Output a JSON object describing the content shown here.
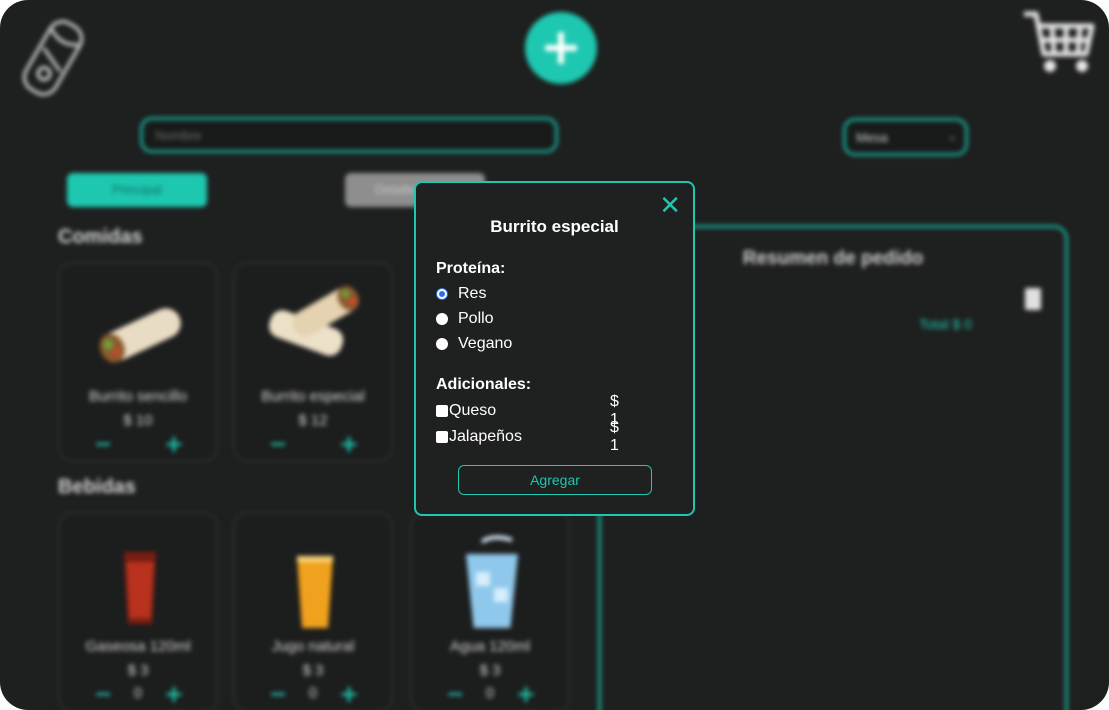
{
  "header": {
    "logo_icon": "burrito-logo-icon",
    "add_icon": "plus-icon",
    "cart_icon": "cart-icon"
  },
  "search": {
    "placeholder": "Nombre"
  },
  "filter": {
    "selected": "Mesa"
  },
  "tabs": [
    {
      "label": "Principal"
    },
    {
      "label": "Detalles"
    }
  ],
  "sections": {
    "comidas": {
      "title": "Comidas",
      "items": [
        {
          "name": "Burrito sencillo",
          "price": "$ 10"
        },
        {
          "name": "Burrito especial",
          "price": "$ 12"
        }
      ]
    },
    "bebidas": {
      "title": "Bebidas",
      "items": [
        {
          "name": "Gaseosa 120ml",
          "price": "$ 3",
          "qty": "0"
        },
        {
          "name": "Jugo natural",
          "price": "$ 3",
          "qty": "0"
        },
        {
          "name": "Agua 120ml",
          "price": "$ 3",
          "qty": "0"
        }
      ]
    }
  },
  "summary": {
    "title": "Resumen de pedido",
    "total": "Total $ 0"
  },
  "modal": {
    "title": "Burrito especial",
    "protein_label": "Proteína:",
    "proteins": [
      {
        "label": "Res",
        "checked": true
      },
      {
        "label": "Pollo",
        "checked": false
      },
      {
        "label": "Vegano",
        "checked": false
      }
    ],
    "extras_label": "Adicionales:",
    "extras": [
      {
        "label": "Queso",
        "price": "$ 1"
      },
      {
        "label": "Jalapeños",
        "price": "$ 1"
      }
    ],
    "button": "Agregar"
  },
  "colors": {
    "accent": "#1ec8b0",
    "background": "#1e1f1f"
  }
}
